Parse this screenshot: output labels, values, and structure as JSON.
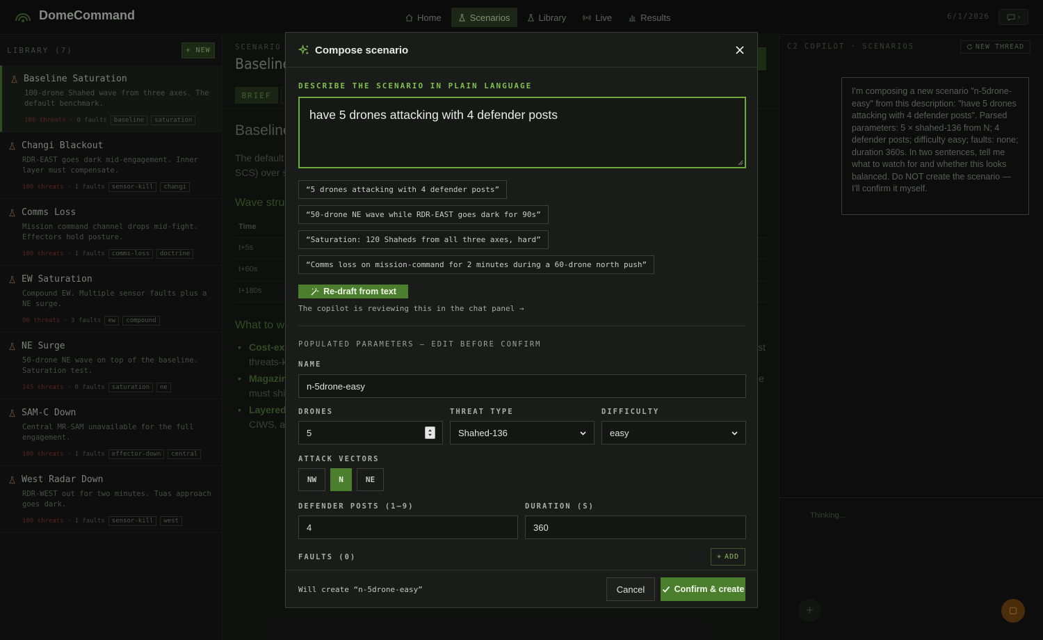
{
  "app": {
    "name": "DomeCommand",
    "date": "6/1/2026"
  },
  "nav": [
    {
      "label": "Home",
      "icon": "home-icon"
    },
    {
      "label": "Scenarios",
      "icon": "flask-icon"
    },
    {
      "label": "Library",
      "icon": "flask-icon"
    },
    {
      "label": "Live",
      "icon": "broadcast-icon"
    },
    {
      "label": "Results",
      "icon": "bar-chart-icon"
    }
  ],
  "library": {
    "title": "LIBRARY (7)",
    "new_label": "+ NEW",
    "items": [
      {
        "name": "Baseline Saturation",
        "desc": "100-drone Shahed wave from three axes. The default benchmark.",
        "threats": "100 threats",
        "faults": "· 0 faults",
        "tags": [
          "baseline",
          "saturation"
        ]
      },
      {
        "name": "Changi Blackout",
        "desc": "RDR-EAST goes dark mid-engagement. Inner layer must compensate.",
        "threats": "100 threats",
        "faults": "· 1 faults",
        "tags": [
          "sensor-kill",
          "changi"
        ]
      },
      {
        "name": "Comms Loss",
        "desc": "Mission command channel drops mid-fight. Effectors hold posture.",
        "threats": "100 threats",
        "faults": "· 1 faults",
        "tags": [
          "comms-loss",
          "doctrine"
        ]
      },
      {
        "name": "EW Saturation",
        "desc": "Compound EW. Multiple sensor faults plus a NE surge.",
        "threats": "90 threats",
        "faults": "· 3 faults",
        "tags": [
          "ew",
          "compound"
        ]
      },
      {
        "name": "NE Surge",
        "desc": "50-drone NE wave on top of the baseline. Saturation test.",
        "threats": "145 threats",
        "faults": "· 0 faults",
        "tags": [
          "saturation",
          "ne"
        ]
      },
      {
        "name": "SAM-C Down",
        "desc": "Central MR-SAM unavailable for the full engagement.",
        "threats": "100 threats",
        "faults": "· 1 faults",
        "tags": [
          "effector-down",
          "central"
        ]
      },
      {
        "name": "West Radar Down",
        "desc": "RDR-WEST out for two minutes. Tuas approach goes dark.",
        "threats": "100 threats",
        "faults": "· 1 faults",
        "tags": [
          "sensor-kill",
          "west"
        ]
      }
    ]
  },
  "background": {
    "scenario_label": "SCENARIO",
    "scenario_title": "Baseline",
    "brief_tab": "BRIEF",
    "section_title": "Baseline",
    "intro_1": "The default",
    "intro_2": "SCS) over s",
    "wave_heading": "Wave struc",
    "time_header": "Time",
    "times": [
      "t+5s",
      "t+60s",
      "t+180s"
    ],
    "watch_heading": "What to wa",
    "bullets": [
      {
        "strong": "Cost-exc",
        "rest": "threats-k",
        "tail": "st"
      },
      {
        "strong": "Magazin",
        "rest": "must shi",
        "tail": "e"
      },
      {
        "strong": "Layered",
        "rest": "CIWS, ar",
        "tail": ""
      }
    ]
  },
  "copilot": {
    "title": "C2 COPILOT · SCENARIOS",
    "new_thread": "NEW THREAD",
    "message": "I'm composing a new scenario \"n-5drone-easy\" from this description: \"have 5 drones attacking with 4 defender posts\". Parsed parameters: 5 × shahed-136 from N; 4 defender posts; difficulty easy; faults: none; duration 360s. In two sentences, tell me what to watch for and whether this looks balanced. Do NOT create the scenario — I'll confirm it myself.",
    "thinking": "Thinking..."
  },
  "modal": {
    "title": "Compose scenario",
    "describe_label": "DESCRIBE THE SCENARIO IN PLAIN LANGUAGE",
    "prompt_value": "have 5 drones attacking with 4 defender posts",
    "suggestions": [
      "“5 drones attacking with 4 defender posts”",
      "“50-drone NE wave while RDR-EAST goes dark for 90s”",
      "“Saturation: 120 Shaheds from all three axes, hard”",
      "“Comms loss on mission-command for 2 minutes during a 60-drone north push”"
    ],
    "redraft_label": "Re-draft from text",
    "review_note": "The copilot is reviewing this in the chat panel →",
    "populated_label": "POPULATED PARAMETERS — EDIT BEFORE CONFIRM",
    "name_label": "NAME",
    "name_value": "n-5drone-easy",
    "drones_label": "DRONES",
    "drones_value": "5",
    "threat_label": "THREAT TYPE",
    "threat_value": "Shahed-136",
    "difficulty_label": "DIFFICULTY",
    "difficulty_value": "easy",
    "vectors_label": "ATTACK VECTORS",
    "vectors": [
      {
        "label": "NW",
        "active": false
      },
      {
        "label": "N",
        "active": true
      },
      {
        "label": "NE",
        "active": false
      }
    ],
    "posts_label": "DEFENDER POSTS (1–9)",
    "posts_value": "4",
    "duration_label": "DURATION (S)",
    "duration_value": "360",
    "faults_label": "FAULTS (0)",
    "add_label": "ADD",
    "will_create": "Will create “n-5drone-easy”",
    "cancel_label": "Cancel",
    "confirm_label": "Confirm & create"
  },
  "colors": {
    "accent": "#4b7f2d",
    "prompt_border": "#6aab3a",
    "threats": "#8a3a35",
    "send": "#7a4a14"
  }
}
